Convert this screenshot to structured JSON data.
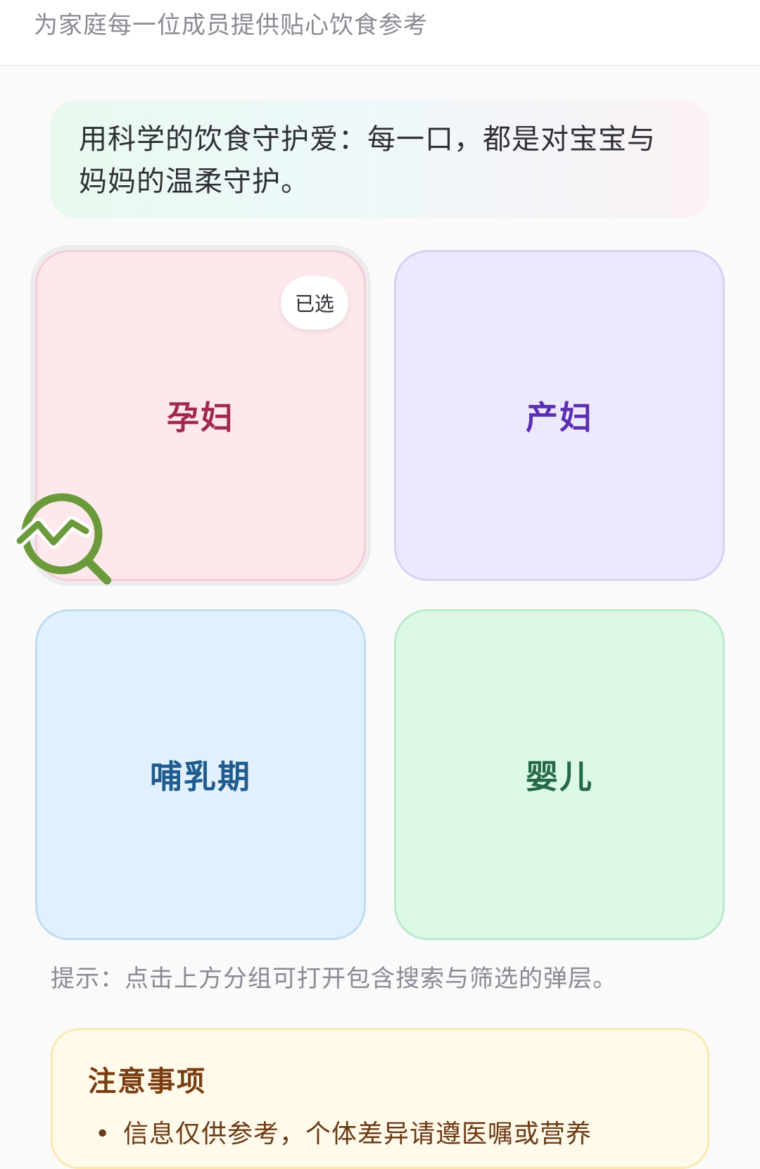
{
  "header": {
    "subtitle": "为家庭每一位成员提供贴心饮食参考"
  },
  "banner": {
    "text": "用科学的饮食守护爱：每一口，都是对宝宝与妈妈的温柔守护。"
  },
  "groups": [
    {
      "label": "孕妇",
      "selected": true,
      "badge": "已选",
      "color": "#a12a4a",
      "background": "#fde8ec"
    },
    {
      "label": "产妇",
      "selected": false,
      "color": "#5b2fb0",
      "background": "#ece8fd"
    },
    {
      "label": "哺乳期",
      "selected": false,
      "color": "#1f5b8e",
      "background": "#e1f0fd"
    },
    {
      "label": "婴儿",
      "selected": false,
      "color": "#25684a",
      "background": "#dcf8e6"
    }
  ],
  "floating_icon": {
    "name": "trend-search-icon",
    "color": "#6a9a3a"
  },
  "tip": "提示：点击上方分组可打开包含搜索与筛选的弹层。",
  "notice": {
    "title": "注意事项",
    "items": [
      "信息仅供参考，个体差异请遵医嘱或营养"
    ]
  }
}
